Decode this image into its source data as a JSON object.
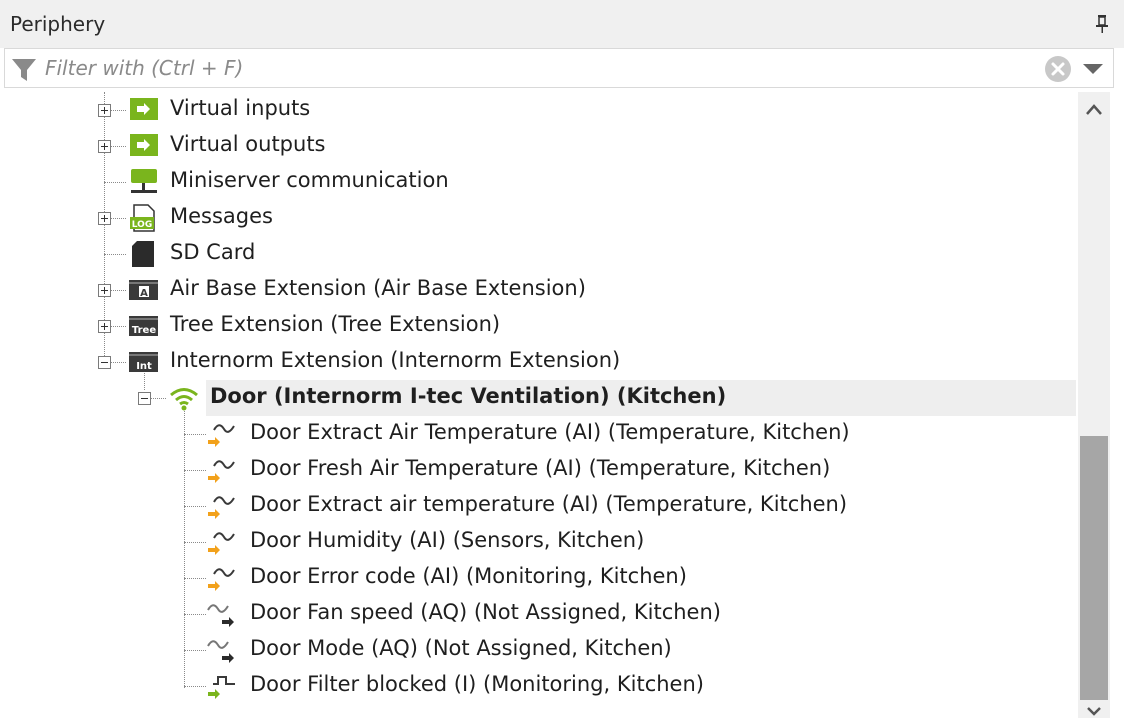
{
  "panel": {
    "title": "Periphery"
  },
  "filter": {
    "placeholder": "Filter with (Ctrl + F)"
  },
  "tree": {
    "items": [
      {
        "label": "Virtual inputs",
        "icon": "virtual-input-icon"
      },
      {
        "label": "Virtual outputs",
        "icon": "virtual-output-icon"
      },
      {
        "label": "Miniserver communication",
        "icon": "network-icon"
      },
      {
        "label": "Messages",
        "icon": "log-icon"
      },
      {
        "label": "SD Card",
        "icon": "sd-card-icon"
      },
      {
        "label": "Air Base Extension (Air Base Extension)",
        "icon": "air-extension-icon"
      },
      {
        "label": "Tree Extension (Tree Extension)",
        "icon": "tree-extension-icon"
      },
      {
        "label": "Internorm Extension (Internorm Extension)",
        "icon": "internorm-extension-icon"
      },
      {
        "label": "Door (Internorm I-tec Ventilation) (Kitchen)",
        "icon": "wireless-icon"
      },
      {
        "label": "Door Extract Air Temperature (AI) (Temperature, Kitchen)",
        "icon": "analog-input-icon"
      },
      {
        "label": "Door Fresh Air Temperature (AI) (Temperature, Kitchen)",
        "icon": "analog-input-icon"
      },
      {
        "label": "Door Extract air temperature (AI) (Temperature, Kitchen)",
        "icon": "analog-input-icon"
      },
      {
        "label": "Door Humidity (AI) (Sensors, Kitchen)",
        "icon": "analog-input-icon"
      },
      {
        "label": "Door Error code (AI) (Monitoring, Kitchen)",
        "icon": "analog-input-icon"
      },
      {
        "label": "Door Fan speed (AQ) (Not Assigned, Kitchen)",
        "icon": "analog-output-icon"
      },
      {
        "label": "Door Mode (AQ) (Not Assigned, Kitchen)",
        "icon": "analog-output-icon"
      },
      {
        "label": "Door Filter blocked (I) (Monitoring, Kitchen)",
        "icon": "digital-input-icon"
      }
    ]
  },
  "colors": {
    "green": "#7ab51d",
    "orange": "#f2a11b",
    "dark": "#3a3a3a"
  }
}
